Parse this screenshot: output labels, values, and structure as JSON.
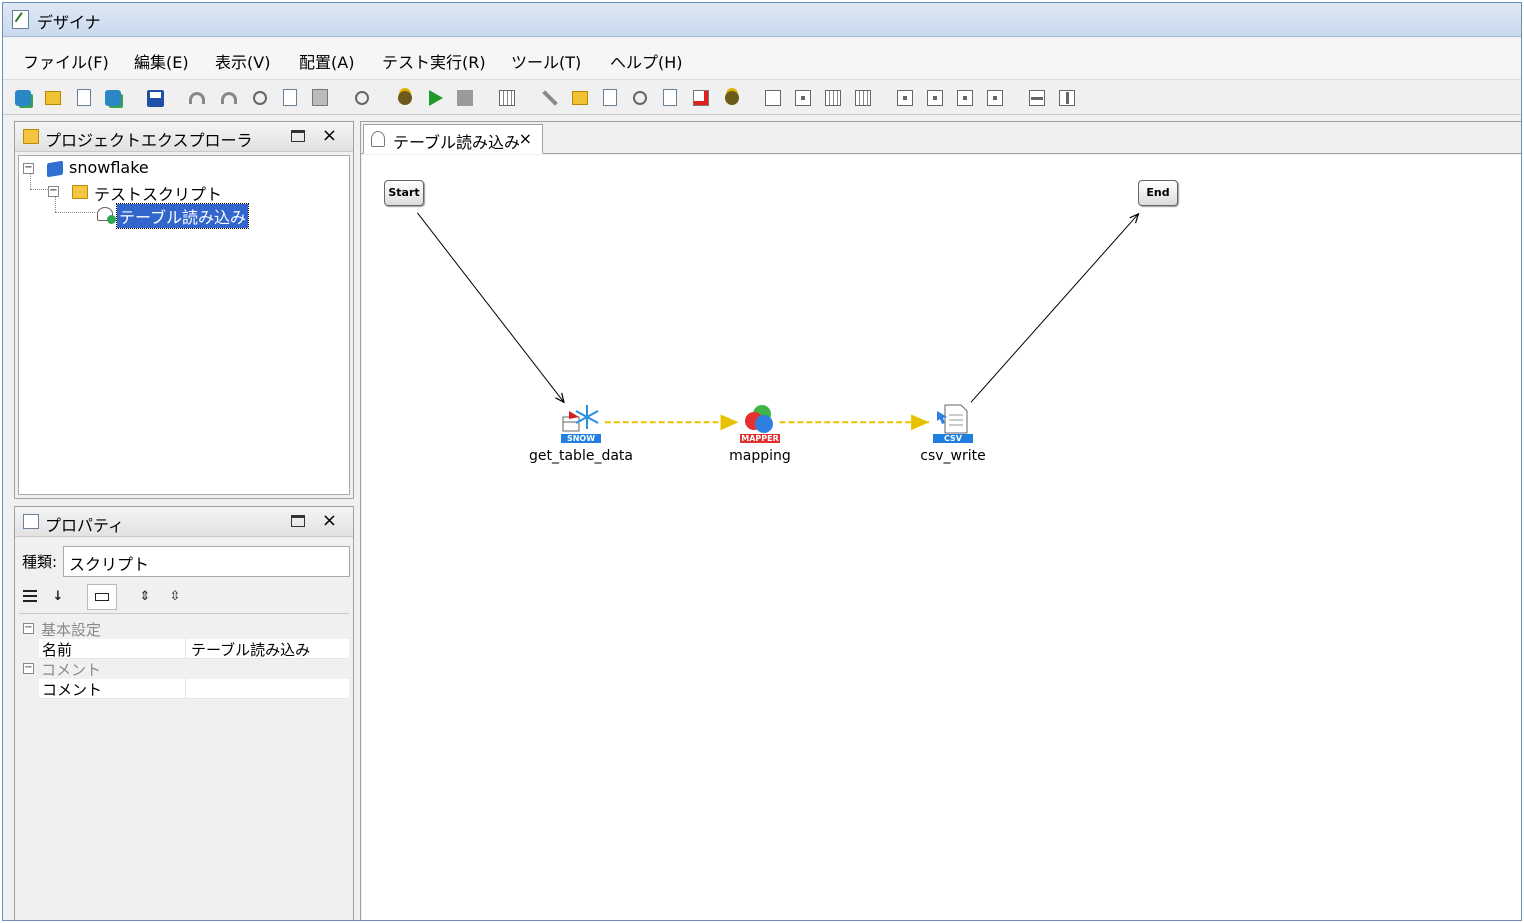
{
  "window": {
    "title": "デザイナ"
  },
  "menu": [
    "ファイル(F)",
    "編集(E)",
    "表示(V)",
    "配置(A)",
    "テスト実行(R)",
    "ツール(T)",
    "ヘルプ(H)"
  ],
  "explorer": {
    "title": "プロジェクトエクスプローラ",
    "close": "×",
    "tree": {
      "root": "snowflake",
      "folder": "テストスクリプト",
      "script": "テーブル読み込み"
    }
  },
  "properties": {
    "title": "プロパティ",
    "close": "×",
    "kind_label": "種類:",
    "kind_value": "スクリプト",
    "categories": [
      {
        "name": "基本設定",
        "rows": [
          {
            "name": "名前",
            "value": "テーブル読み込み"
          }
        ]
      },
      {
        "name": "コメント",
        "rows": [
          {
            "name": "コメント",
            "value": ""
          }
        ]
      }
    ]
  },
  "editor": {
    "tab_label": "テーブル読み込み",
    "tab_close": "×",
    "start_label": "Start",
    "end_label": "End",
    "nodes": [
      {
        "badge": "SNOW",
        "label": "get_table_data",
        "badge_color": "#1f7fe0"
      },
      {
        "badge": "MAPPER",
        "label": "mapping",
        "badge_color": "#e03030"
      },
      {
        "badge": "CSV",
        "label": "csv_write",
        "badge_color": "#1f7fe0"
      }
    ]
  },
  "colors": {
    "selection": "#3366cc",
    "dataflow": "#e8c200"
  }
}
